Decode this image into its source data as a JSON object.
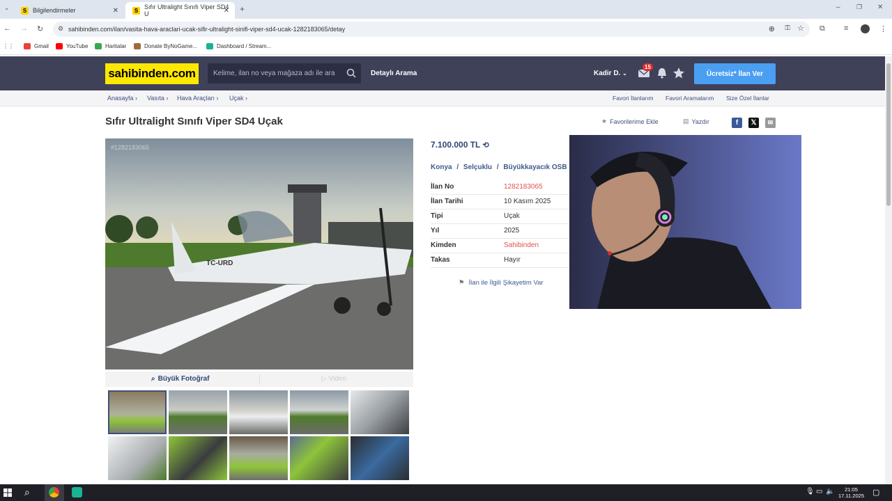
{
  "browser": {
    "tabs": [
      {
        "label": "Bilgilendirmeler"
      },
      {
        "label": "Sıfır Ultralight Sınıfı Viper SD4 U"
      }
    ],
    "url": "sahibinden.com/ilan/vasita-hava-araclari-ucak-sifir-ultralight-sinifi-viper-sd4-ucak-1282183065/detay",
    "bookmarks": [
      "Gmail",
      "YouTube",
      "Haritalar",
      "Donate ByNoGame...",
      "Dashboard / Stream..."
    ]
  },
  "header": {
    "logo": "sahibinden.com",
    "search_placeholder": "Kelime, ilan no veya mağaza adı ile ara",
    "detayli": "Detaylı Arama",
    "user": "Kadir D.",
    "message_count": "15",
    "post_button": "Ücretsiz* İlan Ver"
  },
  "breadcrumb": [
    "Anasayfa",
    "Vasıta",
    "Hava Araçları",
    "Uçak"
  ],
  "top_links": [
    "Favori İlanlarım",
    "Favori Aramalarım",
    "Size Özel İlanlar"
  ],
  "listing": {
    "title": "Sıfır Ultralight Sınıfı Viper SD4 Uçak",
    "favorite_label": "Favorilerime Ekle",
    "print_label": "Yazdır",
    "photo_watermark": "#1282183065",
    "buyuk_foto": "Büyük Fotoğraf",
    "video": "Video",
    "price": "7.100.000 TL",
    "location": [
      "Konya",
      "Selçuklu",
      "Büyükkayacık OSB"
    ],
    "loc_sep": "/",
    "details": [
      {
        "key": "İlan No",
        "value": "1282183065"
      },
      {
        "key": "İlan Tarihi",
        "value": "10 Kasım 2025"
      },
      {
        "key": "Tipi",
        "value": "Uçak"
      },
      {
        "key": "Yıl",
        "value": "2025"
      },
      {
        "key": "Kimden",
        "value": "Sahibinden"
      },
      {
        "key": "Takas",
        "value": "Hayır"
      }
    ],
    "complaint": "İlan ile İlgili Şikayetim Var"
  },
  "taskbar": {
    "time": "21:05",
    "date": "17.11.2025"
  },
  "colors": {
    "header_bg": "#3e4158",
    "logo_bg": "#ffe800",
    "accent": "#4a9ff2",
    "link": "#3e4f7a"
  }
}
